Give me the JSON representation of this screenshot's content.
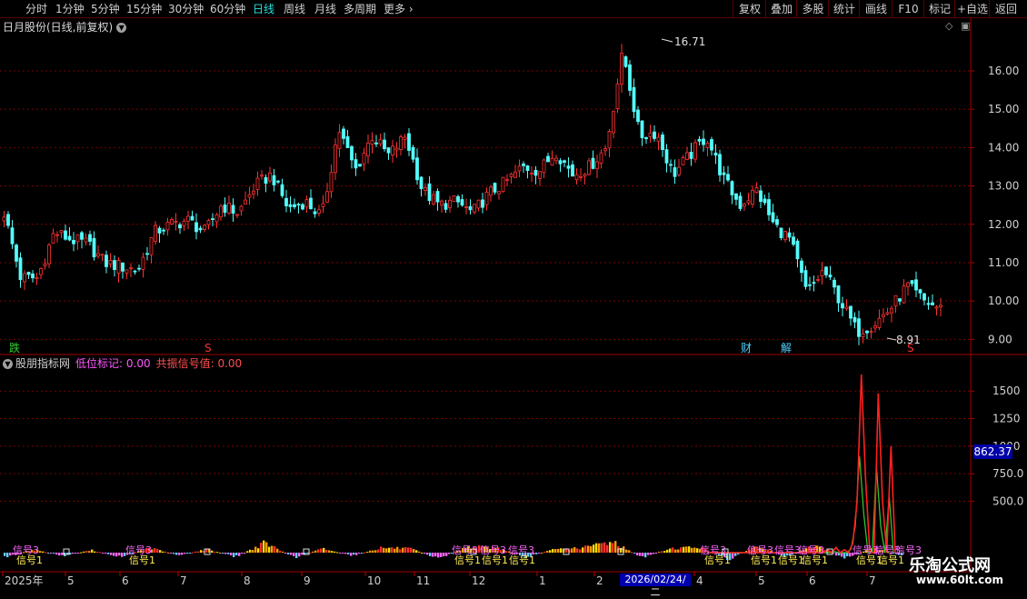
{
  "toolbar": {
    "periods": [
      "分时",
      "1分钟",
      "5分钟",
      "15分钟",
      "30分钟",
      "60分钟",
      "日线",
      "周线",
      "月线",
      "多周期",
      "更多"
    ],
    "active_period": "日线",
    "buttons": [
      "复权",
      "叠加",
      "多股",
      "统计",
      "画线",
      "F10",
      "标记",
      "+自选",
      "返回"
    ]
  },
  "main_chart": {
    "title": "日月股份(日线,前复权)",
    "high_label": "16.71",
    "low_label": "8.91",
    "markers": [
      {
        "text": "跌",
        "color": "#30d030"
      },
      {
        "text": "S",
        "color": "#ff3030"
      },
      {
        "text": "财",
        "color": "#50d0ff"
      },
      {
        "text": "解",
        "color": "#50d0ff"
      },
      {
        "text": "S",
        "color": "#ff3030"
      }
    ]
  },
  "indicator": {
    "name": "股朋指标网",
    "low_mark_label": "低位标记: 0.00",
    "resonance_label": "共振信号值: 0.00",
    "current_value": "862.37",
    "signal_text": "信号",
    "signal_labels": [
      "信号3",
      "信号3",
      "信号3",
      "信号3",
      "信号3",
      "信号3",
      "信号3",
      "信号3",
      "信号3",
      "信号3",
      "信号3",
      "信号3"
    ],
    "signal_sub": [
      "信号1",
      "信号1",
      "信号1",
      "信号1",
      "信号1",
      "信号1",
      "信号1",
      "信号1",
      "信号1",
      "信号1",
      "信号1"
    ]
  },
  "axis": {
    "date_labels": [
      "2025年",
      "5",
      "6",
      "7",
      "8",
      "9",
      "10",
      "11",
      "12",
      "1",
      "2",
      "4",
      "5",
      "6",
      "7"
    ],
    "cursor_date": "2026/02/24/二"
  },
  "watermark": {
    "title": "乐淘公式网",
    "url": "www.60lt.com"
  },
  "colors": {
    "up": "#ff3232",
    "down": "#54fcfc",
    "grid": "#7a0000",
    "text": "#c8c8c8",
    "accent": "#28e0e0"
  },
  "chart_data": {
    "type": "candlestick",
    "y_ticks": [
      "16.00",
      "15.00",
      "14.00",
      "13.00",
      "12.00",
      "11.00",
      "10.00",
      "9.00"
    ],
    "ylim": [
      8.7,
      16.9
    ],
    "indicator_ticks": [
      "1500",
      "1250",
      "1000",
      "750.0",
      "500.0"
    ],
    "indicator_ylim": [
      0,
      1700
    ],
    "close_anchors": [
      12.3,
      10.6,
      10.6,
      11.8,
      11.6,
      11.5,
      11.0,
      10.9,
      10.8,
      11.8,
      12.0,
      12.1,
      11.8,
      12.5,
      12.3,
      13.0,
      13.3,
      12.4,
      12.6,
      12.2,
      14.5,
      13.4,
      14.3,
      13.8,
      14.3,
      12.9,
      12.5,
      12.6,
      12.3,
      12.8,
      13.1,
      13.5,
      13.4,
      13.9,
      13.3,
      13.5,
      14.0,
      16.5,
      14.3,
      14.4,
      13.3,
      13.8,
      14.3,
      13.2,
      12.5,
      12.9,
      12.0,
      11.6,
      10.2,
      10.8,
      10.0,
      9.2,
      9.4,
      9.8,
      10.4,
      10.0,
      9.8
    ],
    "osc_anchors": [
      -0.6,
      0.4,
      -0.4,
      0.3,
      -0.5,
      0.6,
      -0.3,
      0.4,
      -0.5,
      1.2,
      -0.6,
      0.5,
      -0.4,
      0.6,
      0.5,
      -0.7,
      0.7,
      0.6,
      -0.5,
      0.4,
      0.6,
      1.4,
      -0.6,
      0.5,
      0.7,
      -0.8,
      0.8,
      -0.5,
      0.9,
      -0.7,
      0.6,
      -0.4
    ],
    "resonance_series": [
      0,
      0,
      0,
      0,
      0,
      0,
      0,
      0,
      0,
      0,
      0,
      0,
      0,
      0,
      0,
      0,
      0,
      0,
      0,
      0,
      0,
      0,
      0,
      0,
      0,
      0,
      0,
      0,
      60,
      0,
      80,
      0,
      60,
      0,
      120,
      500,
      1650,
      700,
      0,
      0,
      1480,
      500,
      0,
      1000,
      0
    ]
  }
}
